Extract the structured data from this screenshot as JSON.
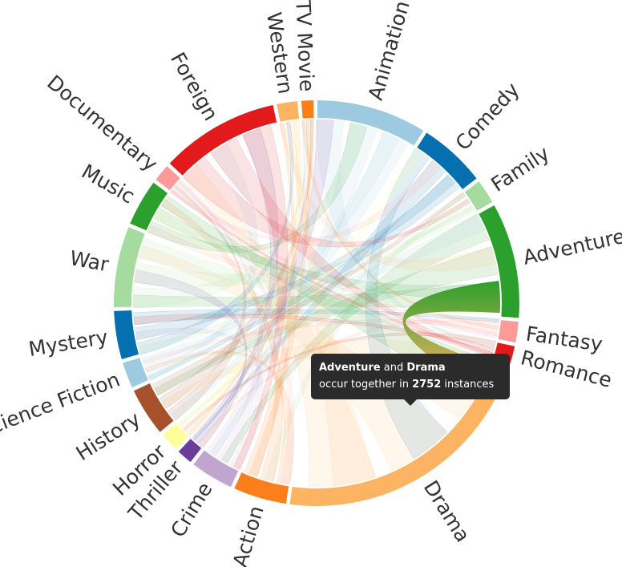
{
  "chart_data": {
    "type": "chord",
    "groups": [
      {
        "name": "Animation",
        "value": 130,
        "color": "#9ecae1"
      },
      {
        "name": "Comedy",
        "value": 80,
        "color": "#0570b0"
      },
      {
        "name": "Family",
        "value": 30,
        "color": "#a6dba0"
      },
      {
        "name": "Adventure",
        "value": 136,
        "color": "#2ca02c"
      },
      {
        "name": "Fantasy",
        "value": 26,
        "color": "#fb9a99"
      },
      {
        "name": "Romance",
        "value": 22,
        "color": "#e31a1c"
      },
      {
        "name": "Drama",
        "value": 324,
        "color": "#fdb462"
      },
      {
        "name": "Action",
        "value": 64,
        "color": "#fd7f1c"
      },
      {
        "name": "Crime",
        "value": 52,
        "color": "#c2a5cf"
      },
      {
        "name": "Thriller",
        "value": 20,
        "color": "#6a3d9a"
      },
      {
        "name": "Horror",
        "value": 24,
        "color": "#ffff99"
      },
      {
        "name": "History",
        "value": 58,
        "color": "#a6512c"
      },
      {
        "name": "Science Fiction",
        "value": 32,
        "color": "#9ecae1"
      },
      {
        "name": "Mystery",
        "value": 58,
        "color": "#0570b0"
      },
      {
        "name": "War",
        "value": 96,
        "color": "#a6dba0"
      },
      {
        "name": "Music",
        "value": 56,
        "color": "#2ca02c"
      },
      {
        "name": "Documentary",
        "value": 22,
        "color": "#fb9a99"
      },
      {
        "name": "Foreign",
        "value": 140,
        "color": "#e31a1c"
      },
      {
        "name": "Western",
        "value": 26,
        "color": "#fdb462"
      },
      {
        "name": "TV Movie",
        "value": 16,
        "color": "#fd7f1c"
      }
    ],
    "highlighted_link": {
      "source": "Adventure",
      "target": "Drama",
      "count": 2752
    }
  },
  "tooltip": {
    "source": "Adventure",
    "and_text": "and",
    "target": "Drama",
    "line2_pre": "occur together in",
    "count": "2752",
    "line2_post": "instances"
  }
}
